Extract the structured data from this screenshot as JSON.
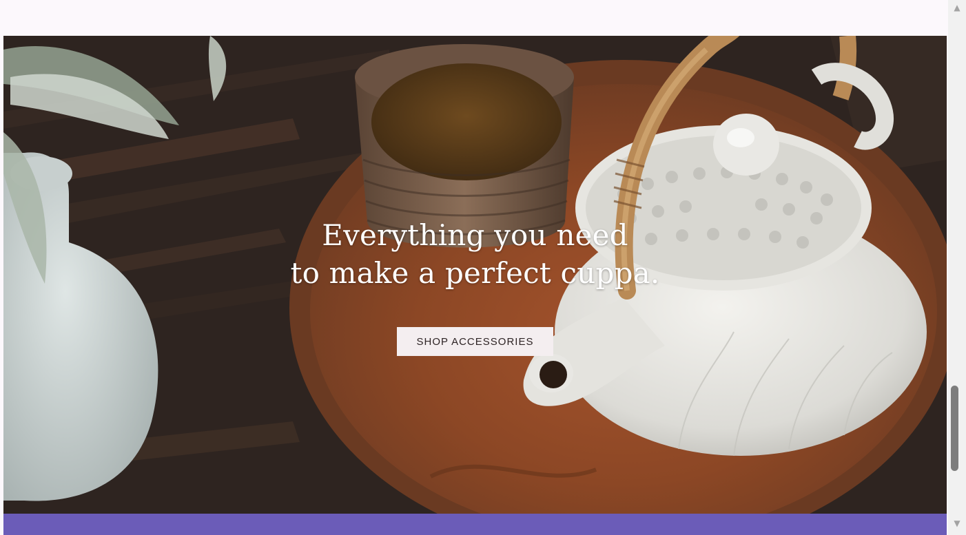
{
  "hero": {
    "headline_line1": "Everything you need",
    "headline_line2": "to make a perfect cuppa.",
    "cta_label": "SHOP ACCESSORIES"
  },
  "scrollbar": {
    "up_icon": "▲",
    "down_icon": "▼"
  },
  "colors": {
    "page_background": "#fcf8fc",
    "brand_band": "#6b5cb8",
    "button_background": "#f4eef0",
    "headline_text": "#ffffff"
  }
}
